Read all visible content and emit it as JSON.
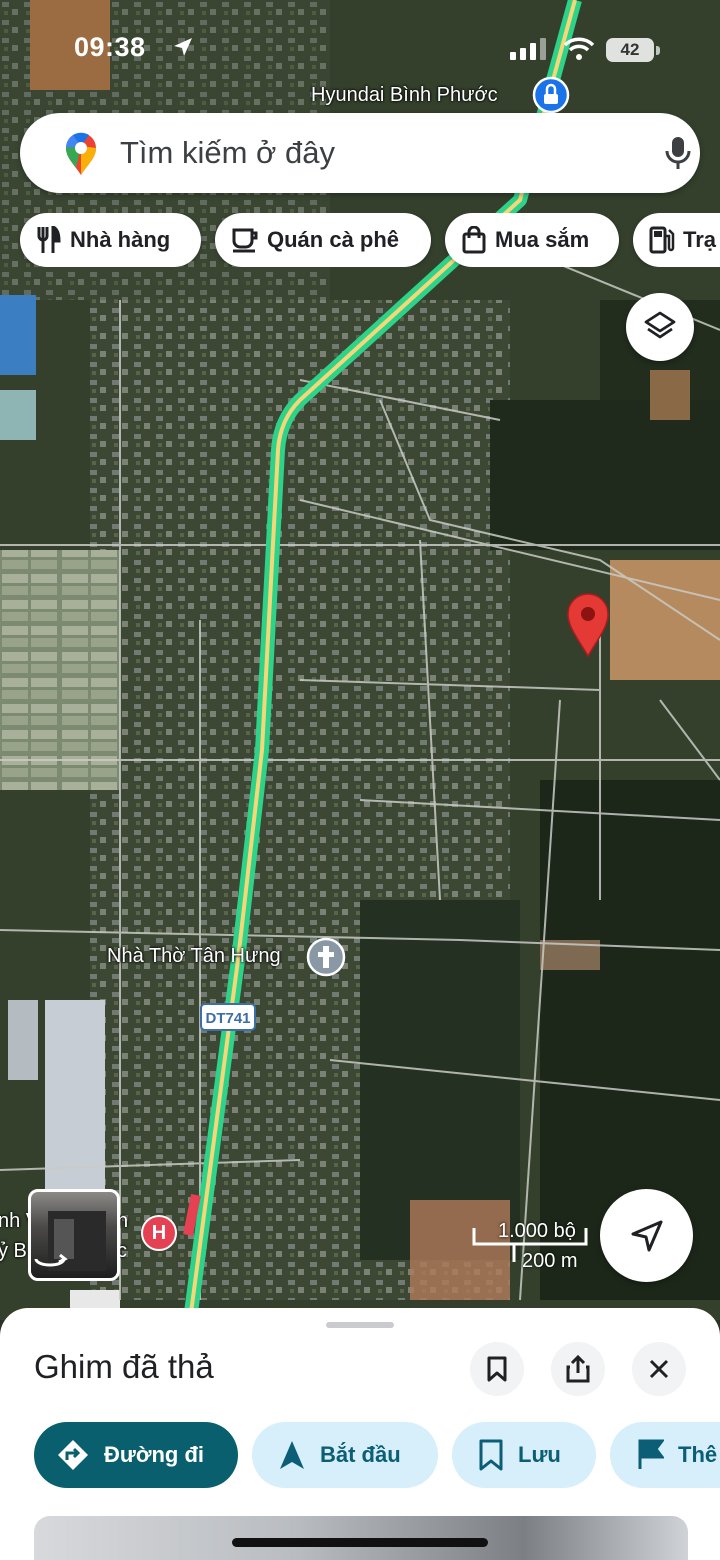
{
  "status_bar": {
    "time": "09:38",
    "battery": "42"
  },
  "map": {
    "labels": {
      "hyundai": "Hyundai Bình Phước",
      "church": "Nhà Thờ Tân Hưng",
      "road_shield": "DT741",
      "hospital_letter": "H",
      "partial_left_a": "nh V",
      "partial_left_b": "n",
      "partial_left_c": "ỷ B",
      "partial_left_d": "c"
    },
    "scale": {
      "imperial": "1.000 bộ",
      "metric": "200 m"
    },
    "colors": {
      "route": "#2ed38a",
      "road_core": "#f5d77a",
      "pin": "#e53935"
    }
  },
  "search": {
    "placeholder": "Tìm kiếm ở đây"
  },
  "chips": [
    {
      "label": "Nhà hàng",
      "icon": "fork-knife-icon"
    },
    {
      "label": "Quán cà phê",
      "icon": "coffee-cup-icon"
    },
    {
      "label": "Mua sắm",
      "icon": "shopping-bag-icon"
    },
    {
      "label": "Trạ",
      "icon": "gas-station-icon"
    }
  ],
  "sheet": {
    "title": "Ghim đã thả",
    "actions": [
      {
        "label": "Đường đi",
        "icon": "directions-icon"
      },
      {
        "label": "Bắt đầu",
        "icon": "navigation-arrow-icon"
      },
      {
        "label": "Lưu",
        "icon": "bookmark-icon"
      },
      {
        "label": "Thê",
        "icon": "flag-icon"
      }
    ]
  }
}
